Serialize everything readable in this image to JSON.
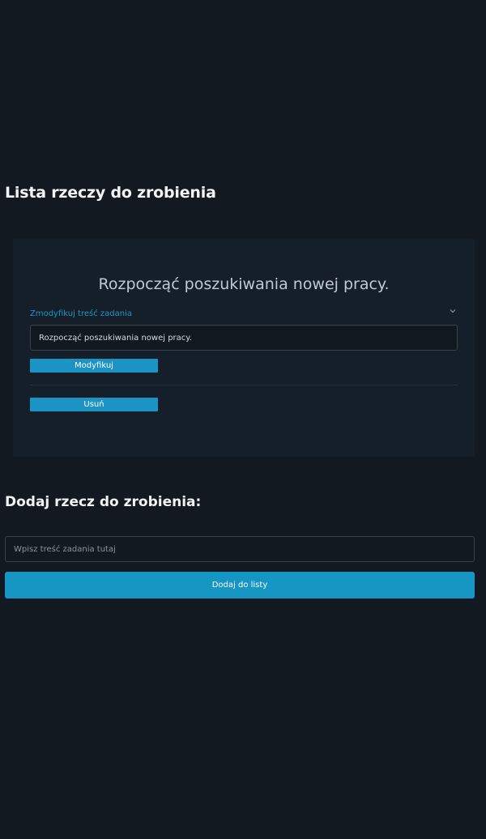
{
  "list": {
    "title": "Lista rzeczy do zrobienia",
    "tasks": [
      {
        "text": "Rozpocząć poszukiwania nowej pracy.",
        "edit_toggle_label": "Zmodyfikuj treść zadania",
        "edit_value": "Rozpocząć poszukiwania nowej pracy.",
        "modify_label": "Modyfikuj",
        "delete_label": "Usuń"
      }
    ]
  },
  "add": {
    "title": "Dodaj rzecz do zrobienia:",
    "placeholder": "Wpisz treść zadania tutaj",
    "button_label": "Dodaj do listy"
  },
  "icons": {
    "expand": "chevron-down-icon"
  },
  "colors": {
    "background": "#121921",
    "card": "#151f29",
    "accent": "#1596c3"
  }
}
